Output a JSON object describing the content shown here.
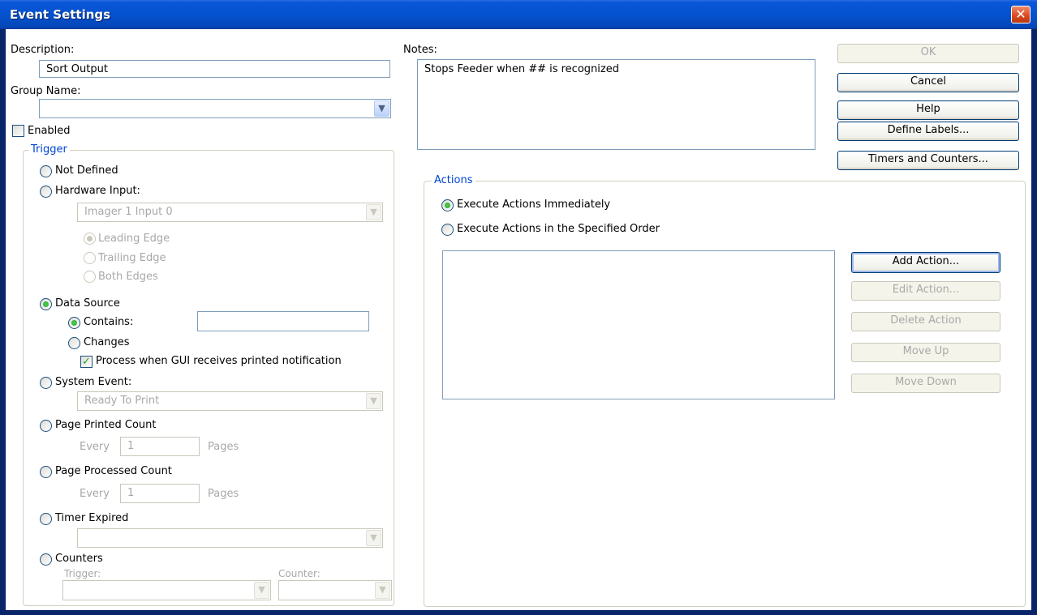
{
  "window": {
    "title": "Event Settings",
    "close_glyph": "✕"
  },
  "description": {
    "label": "Description:",
    "value": "Sort Output"
  },
  "group_name": {
    "label": "Group Name:",
    "value": ""
  },
  "enabled": {
    "label": "Enabled",
    "checked": false
  },
  "notes": {
    "label": "Notes:",
    "value": "Stops Feeder when ## is recognized"
  },
  "buttons": {
    "ok": "OK",
    "cancel": "Cancel",
    "help": "Help",
    "define_labels": "Define Labels...",
    "timers_counters": "Timers and Counters..."
  },
  "trigger": {
    "title": "Trigger",
    "not_defined": "Not Defined",
    "hardware_input": "Hardware Input:",
    "hardware_input_select": "Imager 1 Input 0",
    "leading_edge": "Leading Edge",
    "trailing_edge": "Trailing Edge",
    "both_edges": "Both Edges",
    "data_source": "Data Source",
    "contains": "Contains:",
    "contains_value": "",
    "changes": "Changes",
    "process_gui": "Process when GUI receives printed notification",
    "system_event": "System Event:",
    "system_event_select": "Ready To Print",
    "page_printed_count": "Page Printed Count",
    "page_processed_count": "Page Processed Count",
    "every": "Every",
    "pages": "Pages",
    "printed_every_value": "1",
    "processed_every_value": "1",
    "timer_expired": "Timer Expired",
    "timer_select": "",
    "counters": "Counters",
    "counters_trigger_label": "Trigger:",
    "counters_counter_label": "Counter:",
    "selected": "data_source"
  },
  "actions": {
    "title": "Actions",
    "execute_immediately": "Execute Actions Immediately",
    "execute_in_order": "Execute Actions in the Specified Order",
    "add": "Add Action...",
    "edit": "Edit Action...",
    "delete": "Delete Action",
    "move_up": "Move Up",
    "move_down": "Move Down",
    "items": []
  },
  "icons": {
    "dropdown": "chevron-down-icon",
    "check": "checkmark-icon"
  },
  "colors": {
    "title_bar": "#0552CF",
    "group_title": "#0046D5",
    "radio_dot": "#21A121"
  }
}
